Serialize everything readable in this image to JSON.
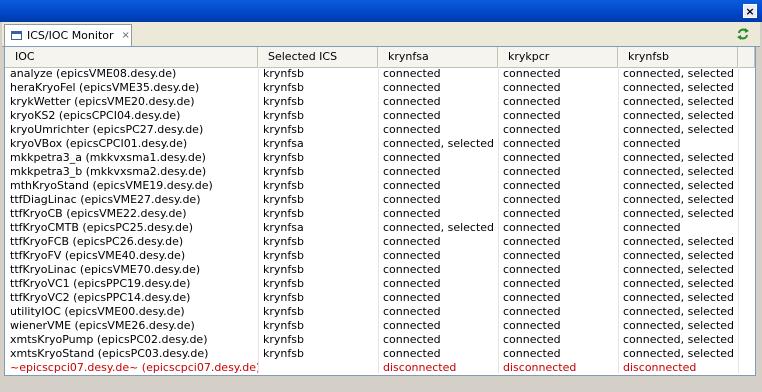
{
  "window": {
    "close_glyph": "×"
  },
  "tab": {
    "label": "ICS/IOC Monitor",
    "close_glyph": "×"
  },
  "table": {
    "columns": [
      "IOC",
      "Selected ICS",
      "krynfsa",
      "krykpcr",
      "krynfsb"
    ],
    "rows": [
      {
        "ioc": "analyze (epicsVME08.desy.de)",
        "sel": "krynfsb",
        "a": "connected",
        "b": "connected",
        "c": "connected, selected"
      },
      {
        "ioc": "heraKryoFel (epicsVME35.desy.de)",
        "sel": "krynfsb",
        "a": "connected",
        "b": "connected",
        "c": "connected, selected"
      },
      {
        "ioc": "krykWetter (epicsVME20.desy.de)",
        "sel": "krynfsb",
        "a": "connected",
        "b": "connected",
        "c": "connected, selected"
      },
      {
        "ioc": "kryoKS2 (epicsCPCI04.desy.de)",
        "sel": "krynfsb",
        "a": "connected",
        "b": "connected",
        "c": "connected, selected"
      },
      {
        "ioc": "kryoUmrichter (epicsPC27.desy.de)",
        "sel": "krynfsb",
        "a": "connected",
        "b": "connected",
        "c": "connected, selected"
      },
      {
        "ioc": "kryoVBox (epicsCPCI01.desy.de)",
        "sel": "krynfsa",
        "a": "connected, selected",
        "b": "connected",
        "c": "connected"
      },
      {
        "ioc": "mkkpetra3_a (mkkvxsma1.desy.de)",
        "sel": "krynfsb",
        "a": "connected",
        "b": "connected",
        "c": "connected, selected"
      },
      {
        "ioc": "mkkpetra3_b (mkkvxsma2.desy.de)",
        "sel": "krynfsb",
        "a": "connected",
        "b": "connected",
        "c": "connected, selected"
      },
      {
        "ioc": "mthKryoStand (epicsVME19.desy.de)",
        "sel": "krynfsb",
        "a": "connected",
        "b": "connected",
        "c": "connected, selected"
      },
      {
        "ioc": "ttfDiagLinac (epicsVME27.desy.de)",
        "sel": "krynfsb",
        "a": "connected",
        "b": "connected",
        "c": "connected, selected"
      },
      {
        "ioc": "ttfKryoCB (epicsVME22.desy.de)",
        "sel": "krynfsb",
        "a": "connected",
        "b": "connected",
        "c": "connected, selected"
      },
      {
        "ioc": "ttfKryoCMTB (epicsPC25.desy.de)",
        "sel": "krynfsa",
        "a": "connected, selected",
        "b": "connected",
        "c": "connected"
      },
      {
        "ioc": "ttfKryoFCB (epicsPC26.desy.de)",
        "sel": "krynfsb",
        "a": "connected",
        "b": "connected",
        "c": "connected, selected"
      },
      {
        "ioc": "ttfKryoFV (epicsVME40.desy.de)",
        "sel": "krynfsb",
        "a": "connected",
        "b": "connected",
        "c": "connected, selected"
      },
      {
        "ioc": "ttfKryoLinac (epicsVME70.desy.de)",
        "sel": "krynfsb",
        "a": "connected",
        "b": "connected",
        "c": "connected, selected"
      },
      {
        "ioc": "ttfKryoVC1 (epicsPPC19.desy.de)",
        "sel": "krynfsb",
        "a": "connected",
        "b": "connected",
        "c": "connected, selected"
      },
      {
        "ioc": "ttfKryoVC2 (epicsPPC14.desy.de)",
        "sel": "krynfsb",
        "a": "connected",
        "b": "connected",
        "c": "connected, selected"
      },
      {
        "ioc": "utilityIOC (epicsVME00.desy.de)",
        "sel": "krynfsb",
        "a": "connected",
        "b": "connected",
        "c": "connected, selected"
      },
      {
        "ioc": "wienerVME (epicsVME26.desy.de)",
        "sel": "krynfsb",
        "a": "connected",
        "b": "connected",
        "c": "connected, selected"
      },
      {
        "ioc": "xmtsKryoPump (epicsPC02.desy.de)",
        "sel": "krynfsb",
        "a": "connected",
        "b": "connected",
        "c": "connected, selected"
      },
      {
        "ioc": "xmtsKryoStand (epicsPC03.desy.de)",
        "sel": "krynfsb",
        "a": "connected",
        "b": "connected",
        "c": "connected, selected"
      },
      {
        "ioc": "~epicscpci07.desy.de~ (epicscpci07.desy.de)",
        "sel": "",
        "a": "disconnected",
        "b": "disconnected",
        "c": "disconnected",
        "error": true
      }
    ]
  },
  "colors": {
    "error": "#cc0000",
    "title_bar": "#0046c8"
  },
  "icons": {
    "tab": "view-icon",
    "refresh": "refresh-icon"
  }
}
